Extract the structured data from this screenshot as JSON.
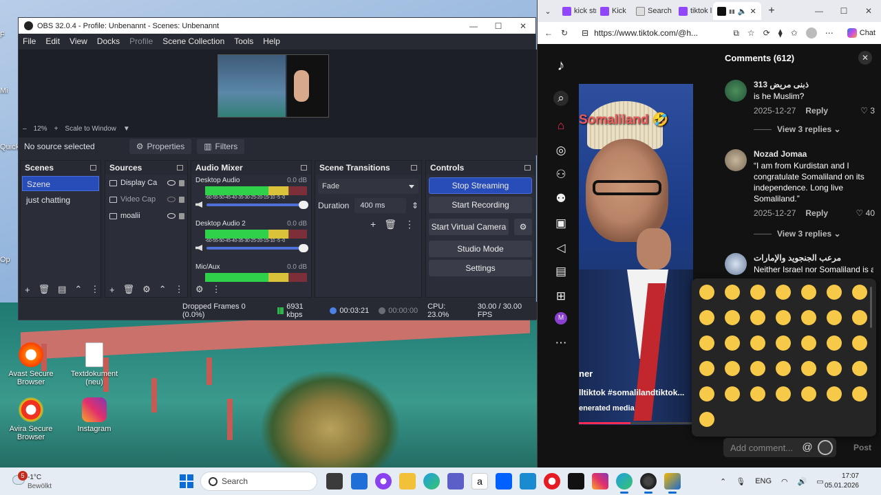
{
  "desktop": {
    "icons": [
      {
        "label": "Avast Secure Browser",
        "color": "#ffffff"
      },
      {
        "label": "Textdokument (neu)",
        "color": "#ffffff"
      },
      {
        "label": "Avira Secure Browser",
        "color": "#ffffff"
      },
      {
        "label": "Instagram",
        "color": "#ffffff"
      }
    ],
    "edge_labels": [
      "Quick",
      "Op",
      "Mi",
      "F"
    ]
  },
  "obs": {
    "title": "OBS 32.0.4 - Profile: Unbenannt - Scenes: Unbenannt",
    "menu": [
      "File",
      "Edit",
      "View",
      "Docks",
      "Profile",
      "Scene Collection",
      "Tools",
      "Help"
    ],
    "zoom": {
      "minus": "–",
      "level": "12%",
      "plus": "+",
      "mode": "Scale to Window"
    },
    "source_bar": {
      "status": "No source selected",
      "properties": "Properties",
      "filters": "Filters"
    },
    "scenes": {
      "title": "Scenes",
      "items": [
        "Szene",
        "just chatting"
      ],
      "selected": 0
    },
    "sources": {
      "title": "Sources",
      "items": [
        "Display Ca",
        "Video Cap",
        "moalii"
      ]
    },
    "mixer": {
      "title": "Audio Mixer",
      "ticks": "-60-55-50-45-40-35-30-25-20-15-10 -5 -0",
      "channels": [
        {
          "name": "Desktop Audio",
          "db": "0.0 dB"
        },
        {
          "name": "Desktop Audio 2",
          "db": "0.0 dB"
        },
        {
          "name": "Mic/Aux",
          "db": "0.0 dB"
        }
      ]
    },
    "transitions": {
      "title": "Scene Transitions",
      "type": "Fade",
      "duration_label": "Duration",
      "duration_value": "400 ms"
    },
    "controls": {
      "title": "Controls",
      "stop_streaming": "Stop Streaming",
      "start_recording": "Start Recording",
      "start_virtual_camera": "Start Virtual Camera",
      "studio_mode": "Studio Mode",
      "settings": "Settings"
    },
    "status": {
      "dropped_frames": "Dropped Frames 0 (0.0%)",
      "bitrate": "6931 kbps",
      "stream_time": "00:03:21",
      "record_time": "00:00:00",
      "cpu": "CPU: 23.0%",
      "fps": "30.00 / 30.00 FPS"
    }
  },
  "browser": {
    "tabs": [
      "kick str",
      "Kick",
      "Search",
      "tiktok l"
    ],
    "url": "https://www.tiktok.com/@h...",
    "chat_label": "Chat",
    "video": {
      "title": "Somaliland 🤣",
      "username": "ner",
      "hashtags": "lltiktok  #somalilandtiktok...",
      "label": "enerated media"
    },
    "comments": {
      "header": "Comments (612)",
      "items": [
        {
          "name": "ذبنى مريض 313",
          "text": "is he Muslim?",
          "date": "2025-12-27",
          "reply": "Reply",
          "likes": "3"
        },
        {
          "name": "Nozad Jomaa",
          "text": "“I am from Kurdistan and I congratulate Somaliland on its independence. Long live Somaliland.”",
          "date": "2025-12-27",
          "reply": "Reply",
          "likes": "40"
        },
        {
          "name": "مرعب الجنجويد والإمارات",
          "text": "Neither Israel nor Somaliland is a",
          "date": "",
          "reply": "",
          "likes": ""
        }
      ],
      "view_replies": "View 3 replies",
      "input_placeholder": "Add comment...",
      "post": "Post"
    },
    "emoji_color": "#f7c948"
  },
  "taskbar": {
    "weather_temp": "-1°C",
    "weather_cond": "Bewölkt",
    "weather_badge": "5",
    "search": "Search",
    "lang": "ENG",
    "time": "17:07",
    "date": "05.01.2026"
  }
}
